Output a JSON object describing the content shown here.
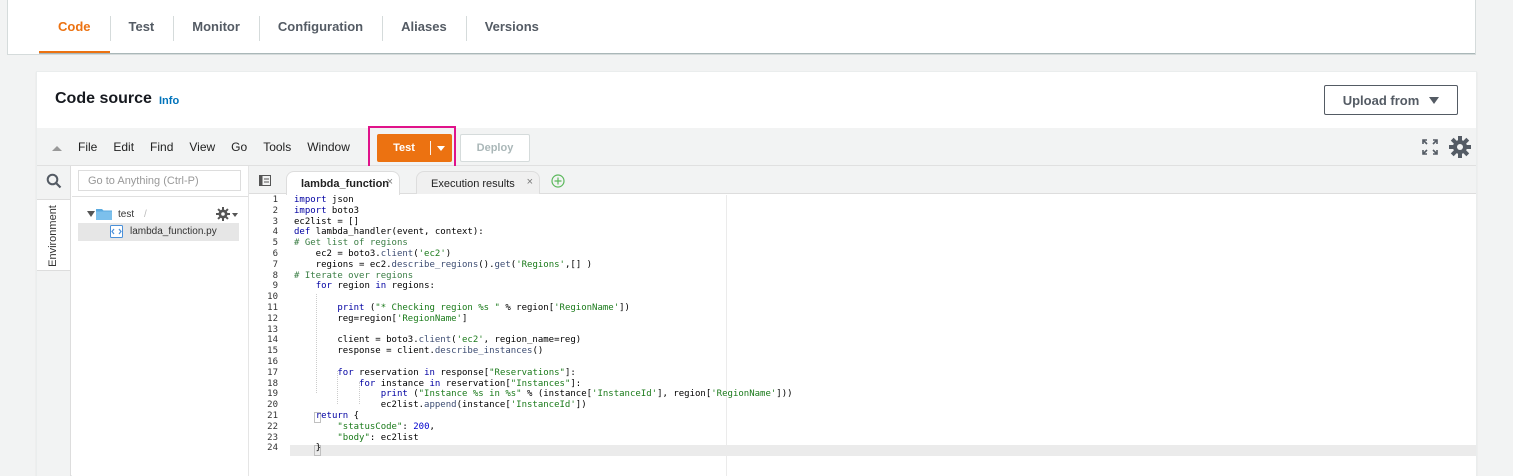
{
  "tabs": [
    {
      "label": "Code",
      "active": true
    },
    {
      "label": "Test",
      "active": false
    },
    {
      "label": "Monitor",
      "active": false
    },
    {
      "label": "Configuration",
      "active": false
    },
    {
      "label": "Aliases",
      "active": false
    },
    {
      "label": "Versions",
      "active": false
    }
  ],
  "panel": {
    "title": "Code source",
    "info": "Info",
    "upload_label": "Upload from"
  },
  "ide": {
    "menu": [
      "File",
      "Edit",
      "Find",
      "View",
      "Go",
      "Tools",
      "Window"
    ],
    "test_label": "Test",
    "deploy_label": "Deploy",
    "goto_placeholder": "Go to Anything (Ctrl-P)",
    "environment_label": "Environment",
    "tree_root": "test",
    "tree_root_suffix": "/",
    "file": "lambda_function.py",
    "editor_tabs": [
      {
        "label": "lambda_function",
        "active": true
      },
      {
        "label": "Execution results",
        "active": false
      }
    ],
    "close_glyph": "×",
    "accent_color": "#ec7211",
    "highlight_color": "#e0128a"
  },
  "code": {
    "line_numbers": [
      "1",
      "2",
      "3",
      "4",
      "5",
      "6",
      "7",
      "8",
      "9",
      "10",
      "11",
      "12",
      "13",
      "14",
      "15",
      "16",
      "17",
      "18",
      "19",
      "20",
      "21",
      "22",
      "23",
      "24"
    ],
    "lines": [
      [
        {
          "t": "import",
          "c": "k"
        },
        {
          "t": " json"
        }
      ],
      [
        {
          "t": "import",
          "c": "k"
        },
        {
          "t": " boto3"
        }
      ],
      [
        {
          "t": "ec2list = []"
        }
      ],
      [
        {
          "t": "def",
          "c": "k"
        },
        {
          "t": " lambda_handler(event, context):"
        }
      ],
      [
        {
          "t": "# Get list of regions",
          "c": "c"
        }
      ],
      [
        {
          "t": "    ec2 = boto3."
        },
        {
          "t": "client",
          "c": "f"
        },
        {
          "t": "("
        },
        {
          "t": "'ec2'",
          "c": "s"
        },
        {
          "t": ")"
        }
      ],
      [
        {
          "t": "    regions = ec2."
        },
        {
          "t": "describe_regions",
          "c": "f"
        },
        {
          "t": "()."
        },
        {
          "t": "get",
          "c": "f"
        },
        {
          "t": "("
        },
        {
          "t": "'Regions'",
          "c": "s"
        },
        {
          "t": ",[] )"
        }
      ],
      [
        {
          "t": "# Iterate over regions",
          "c": "c"
        }
      ],
      [
        {
          "t": "    "
        },
        {
          "t": "for",
          "c": "k"
        },
        {
          "t": " region "
        },
        {
          "t": "in",
          "c": "k"
        },
        {
          "t": " regions:"
        }
      ],
      [
        {
          "t": ""
        }
      ],
      [
        {
          "t": "        "
        },
        {
          "t": "print",
          "c": "k"
        },
        {
          "t": " ("
        },
        {
          "t": "\"* Checking region %s \"",
          "c": "s"
        },
        {
          "t": " % region["
        },
        {
          "t": "'RegionName'",
          "c": "s"
        },
        {
          "t": "])"
        }
      ],
      [
        {
          "t": "        reg=region["
        },
        {
          "t": "'RegionName'",
          "c": "s"
        },
        {
          "t": "]"
        }
      ],
      [
        {
          "t": ""
        }
      ],
      [
        {
          "t": "        client = boto3."
        },
        {
          "t": "client",
          "c": "f"
        },
        {
          "t": "("
        },
        {
          "t": "'ec2'",
          "c": "s"
        },
        {
          "t": ", region_name=reg)"
        }
      ],
      [
        {
          "t": "        response = client."
        },
        {
          "t": "describe_instances",
          "c": "f"
        },
        {
          "t": "()"
        }
      ],
      [
        {
          "t": ""
        }
      ],
      [
        {
          "t": "        "
        },
        {
          "t": "for",
          "c": "k"
        },
        {
          "t": " reservation "
        },
        {
          "t": "in",
          "c": "k"
        },
        {
          "t": " response["
        },
        {
          "t": "\"Reservations\"",
          "c": "s"
        },
        {
          "t": "]:"
        }
      ],
      [
        {
          "t": "            "
        },
        {
          "t": "for",
          "c": "k"
        },
        {
          "t": " instance "
        },
        {
          "t": "in",
          "c": "k"
        },
        {
          "t": " reservation["
        },
        {
          "t": "\"Instances\"",
          "c": "s"
        },
        {
          "t": "]:"
        }
      ],
      [
        {
          "t": "                "
        },
        {
          "t": "print",
          "c": "k"
        },
        {
          "t": " ("
        },
        {
          "t": "\"Instance %s in %s\"",
          "c": "s"
        },
        {
          "t": " % (instance["
        },
        {
          "t": "'InstanceId'",
          "c": "s"
        },
        {
          "t": "], region["
        },
        {
          "t": "'RegionName'",
          "c": "s"
        },
        {
          "t": "]))"
        }
      ],
      [
        {
          "t": "                ec2list."
        },
        {
          "t": "append",
          "c": "f"
        },
        {
          "t": "(instance["
        },
        {
          "t": "'InstanceId'",
          "c": "s"
        },
        {
          "t": "])"
        }
      ],
      [
        {
          "t": "    "
        },
        {
          "t": "return",
          "c": "k"
        },
        {
          "t": " {"
        }
      ],
      [
        {
          "t": "        "
        },
        {
          "t": "\"statusCode\"",
          "c": "s"
        },
        {
          "t": ": "
        },
        {
          "t": "200",
          "c": "n"
        },
        {
          "t": ","
        }
      ],
      [
        {
          "t": "        "
        },
        {
          "t": "\"body\"",
          "c": "s"
        },
        {
          "t": ": ec2list"
        }
      ],
      [
        {
          "t": "    }"
        }
      ]
    ]
  }
}
